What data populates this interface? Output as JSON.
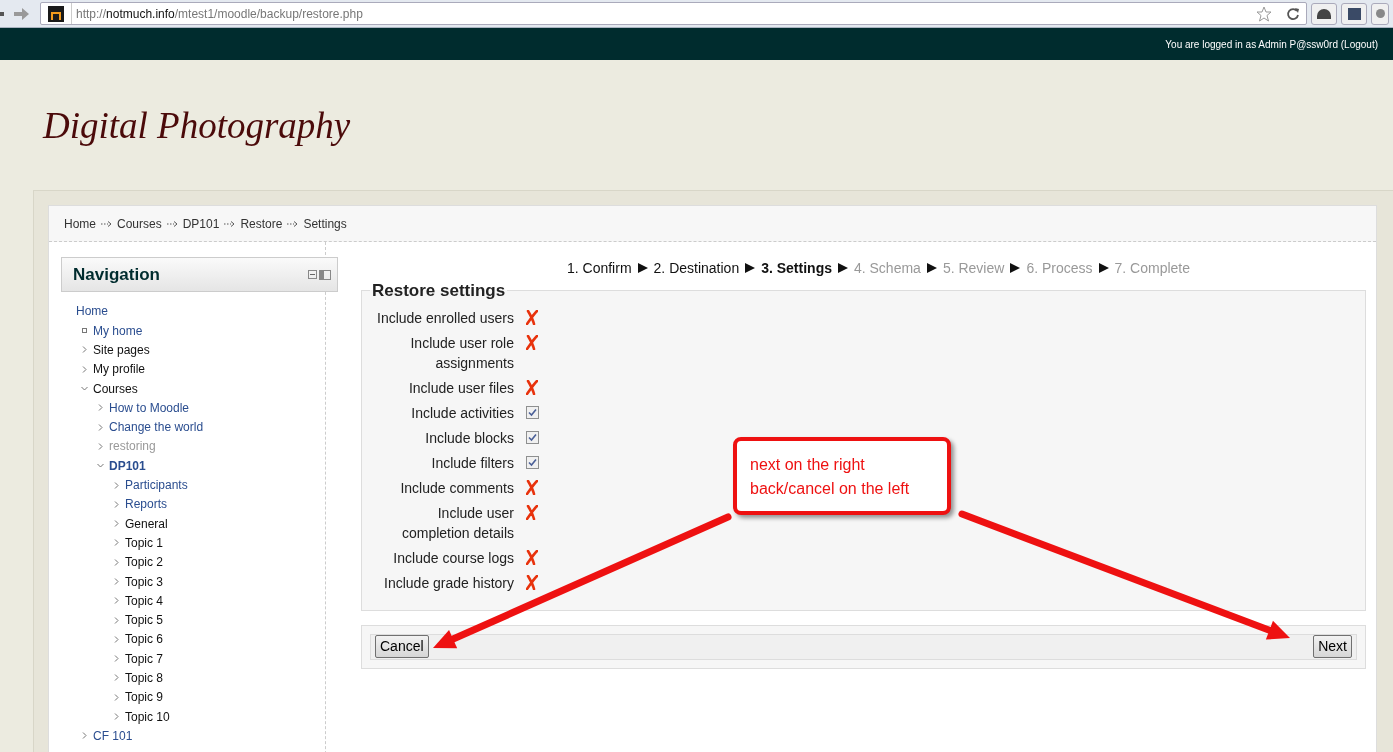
{
  "browser": {
    "url_prefix": "http://",
    "url_host": "notmuch.info",
    "url_path": "/mtest1/moodle/backup/restore.php"
  },
  "topbar": {
    "login_text": "You are logged in as Admin P@ssw0rd (Logout)"
  },
  "site_title": "Digital Photography",
  "breadcrumb": [
    "Home",
    "Courses",
    "DP101",
    "Restore",
    "Settings"
  ],
  "navigation": {
    "title": "Navigation",
    "root": "Home",
    "items": [
      {
        "label": "My home",
        "kind": "leaf",
        "link": true,
        "dimmed": false,
        "current": false
      },
      {
        "label": "Site pages",
        "kind": "branch",
        "link": false,
        "dimmed": false,
        "current": false,
        "expanded": false
      },
      {
        "label": "My profile",
        "kind": "branch",
        "link": false,
        "dimmed": false,
        "current": false,
        "expanded": false
      },
      {
        "label": "Courses",
        "kind": "branch",
        "link": false,
        "dimmed": false,
        "current": false,
        "expanded": true,
        "children": [
          {
            "label": "How to Moodle",
            "kind": "branch",
            "link": true,
            "dimmed": false,
            "current": false,
            "expanded": false
          },
          {
            "label": "Change the world",
            "kind": "branch",
            "link": true,
            "dimmed": false,
            "current": false,
            "expanded": false
          },
          {
            "label": "restoring",
            "kind": "branch",
            "link": true,
            "dimmed": true,
            "current": false,
            "expanded": false
          },
          {
            "label": "DP101",
            "kind": "branch",
            "link": true,
            "dimmed": false,
            "current": true,
            "expanded": true,
            "children": [
              {
                "label": "Participants",
                "kind": "branch",
                "link": true,
                "dimmed": false,
                "current": false,
                "expanded": false
              },
              {
                "label": "Reports",
                "kind": "branch",
                "link": true,
                "dimmed": false,
                "current": false,
                "expanded": false
              },
              {
                "label": "General",
                "kind": "branch",
                "link": false,
                "dimmed": false,
                "current": false,
                "expanded": false
              },
              {
                "label": "Topic 1",
                "kind": "branch",
                "link": false,
                "dimmed": false,
                "current": false,
                "expanded": false
              },
              {
                "label": "Topic 2",
                "kind": "branch",
                "link": false,
                "dimmed": false,
                "current": false,
                "expanded": false
              },
              {
                "label": "Topic 3",
                "kind": "branch",
                "link": false,
                "dimmed": false,
                "current": false,
                "expanded": false
              },
              {
                "label": "Topic 4",
                "kind": "branch",
                "link": false,
                "dimmed": false,
                "current": false,
                "expanded": false
              },
              {
                "label": "Topic 5",
                "kind": "branch",
                "link": false,
                "dimmed": false,
                "current": false,
                "expanded": false
              },
              {
                "label": "Topic 6",
                "kind": "branch",
                "link": false,
                "dimmed": false,
                "current": false,
                "expanded": false
              },
              {
                "label": "Topic 7",
                "kind": "branch",
                "link": false,
                "dimmed": false,
                "current": false,
                "expanded": false
              },
              {
                "label": "Topic 8",
                "kind": "branch",
                "link": false,
                "dimmed": false,
                "current": false,
                "expanded": false
              },
              {
                "label": "Topic 9",
                "kind": "branch",
                "link": false,
                "dimmed": false,
                "current": false,
                "expanded": false
              },
              {
                "label": "Topic 10",
                "kind": "branch",
                "link": false,
                "dimmed": false,
                "current": false,
                "expanded": false
              }
            ]
          }
        ]
      },
      {
        "label": "CF 101",
        "kind": "branch",
        "link": true,
        "dimmed": false,
        "current": false,
        "expanded": false
      }
    ]
  },
  "steps": [
    {
      "label": "1. Confirm",
      "current": false,
      "disabled": false
    },
    {
      "label": "2. Destination",
      "current": false,
      "disabled": false
    },
    {
      "label": "3. Settings",
      "current": true,
      "disabled": false
    },
    {
      "label": "4. Schema",
      "current": false,
      "disabled": true
    },
    {
      "label": "5. Review",
      "current": false,
      "disabled": true
    },
    {
      "label": "6. Process",
      "current": false,
      "disabled": true
    },
    {
      "label": "7. Complete",
      "current": false,
      "disabled": true
    }
  ],
  "settings": {
    "legend": "Restore settings",
    "rows": [
      {
        "label": "Include enrolled users",
        "kind": "locked"
      },
      {
        "label": "Include user role assignments",
        "kind": "locked"
      },
      {
        "label": "Include user files",
        "kind": "locked"
      },
      {
        "label": "Include activities",
        "kind": "checkbox",
        "checked": true
      },
      {
        "label": "Include blocks",
        "kind": "checkbox",
        "checked": true
      },
      {
        "label": "Include filters",
        "kind": "checkbox",
        "checked": true
      },
      {
        "label": "Include comments",
        "kind": "locked"
      },
      {
        "label": "Include user completion details",
        "kind": "locked"
      },
      {
        "label": "Include course logs",
        "kind": "locked"
      },
      {
        "label": "Include grade history",
        "kind": "locked"
      }
    ]
  },
  "buttons": {
    "cancel": "Cancel",
    "next": "Next"
  },
  "annotation": {
    "lines": [
      "next on the right",
      "back/cancel on the left"
    ]
  }
}
